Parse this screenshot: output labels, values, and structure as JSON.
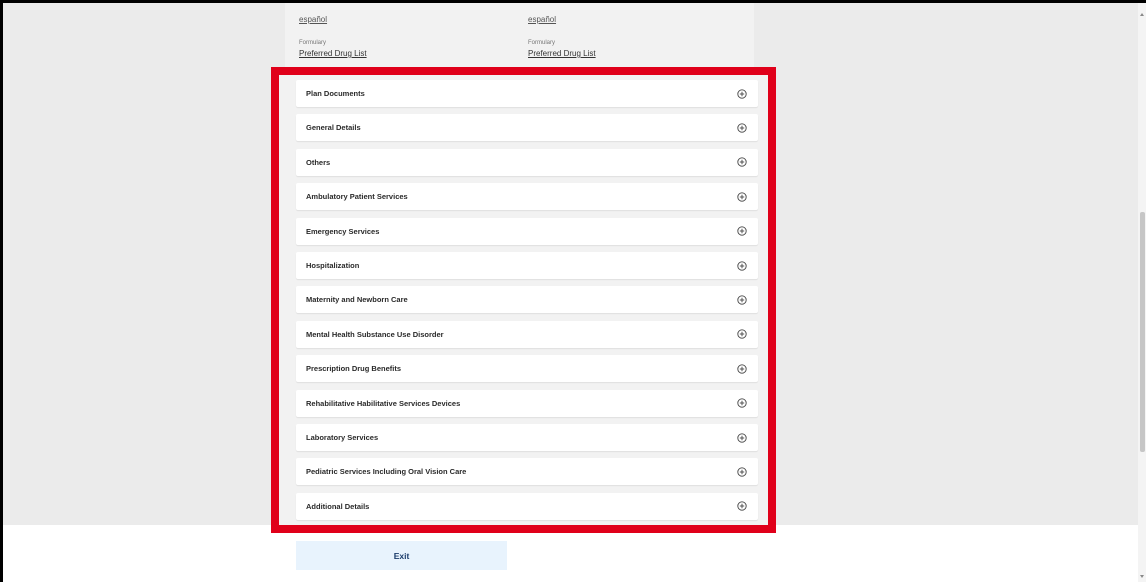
{
  "plans": [
    {
      "language_link": "español",
      "formulary_label": "Formulary",
      "formulary_link": "Preferred Drug List"
    },
    {
      "language_link": "español",
      "formulary_label": "Formulary",
      "formulary_link": "Preferred Drug List"
    }
  ],
  "accordion": {
    "items": [
      {
        "label": "Plan Documents",
        "icon": "plus-circle-icon"
      },
      {
        "label": "General Details",
        "icon": "plus-circle-icon"
      },
      {
        "label": "Others",
        "icon": "plus-circle-icon"
      },
      {
        "label": "Ambulatory Patient Services",
        "icon": "plus-circle-icon"
      },
      {
        "label": "Emergency Services",
        "icon": "plus-circle-icon"
      },
      {
        "label": "Hospitalization",
        "icon": "plus-circle-icon"
      },
      {
        "label": "Maternity and Newborn Care",
        "icon": "plus-circle-icon"
      },
      {
        "label": "Mental Health Substance Use Disorder",
        "icon": "plus-circle-icon"
      },
      {
        "label": "Prescription Drug Benefits",
        "icon": "plus-circle-icon"
      },
      {
        "label": "Rehabilitative Habilitative Services Devices",
        "icon": "plus-circle-icon"
      },
      {
        "label": "Laboratory Services",
        "icon": "plus-circle-icon"
      },
      {
        "label": "Pediatric Services Including Oral Vision Care",
        "icon": "plus-circle-icon"
      },
      {
        "label": "Additional Details",
        "icon": "plus-circle-icon"
      }
    ]
  },
  "footer": {
    "exit_label": "Exit"
  },
  "colors": {
    "highlight": "#e0001a",
    "exit_button_bg": "#e8f3fd",
    "exit_button_text": "#1b3c6b",
    "page_bg": "#ebebeb"
  }
}
